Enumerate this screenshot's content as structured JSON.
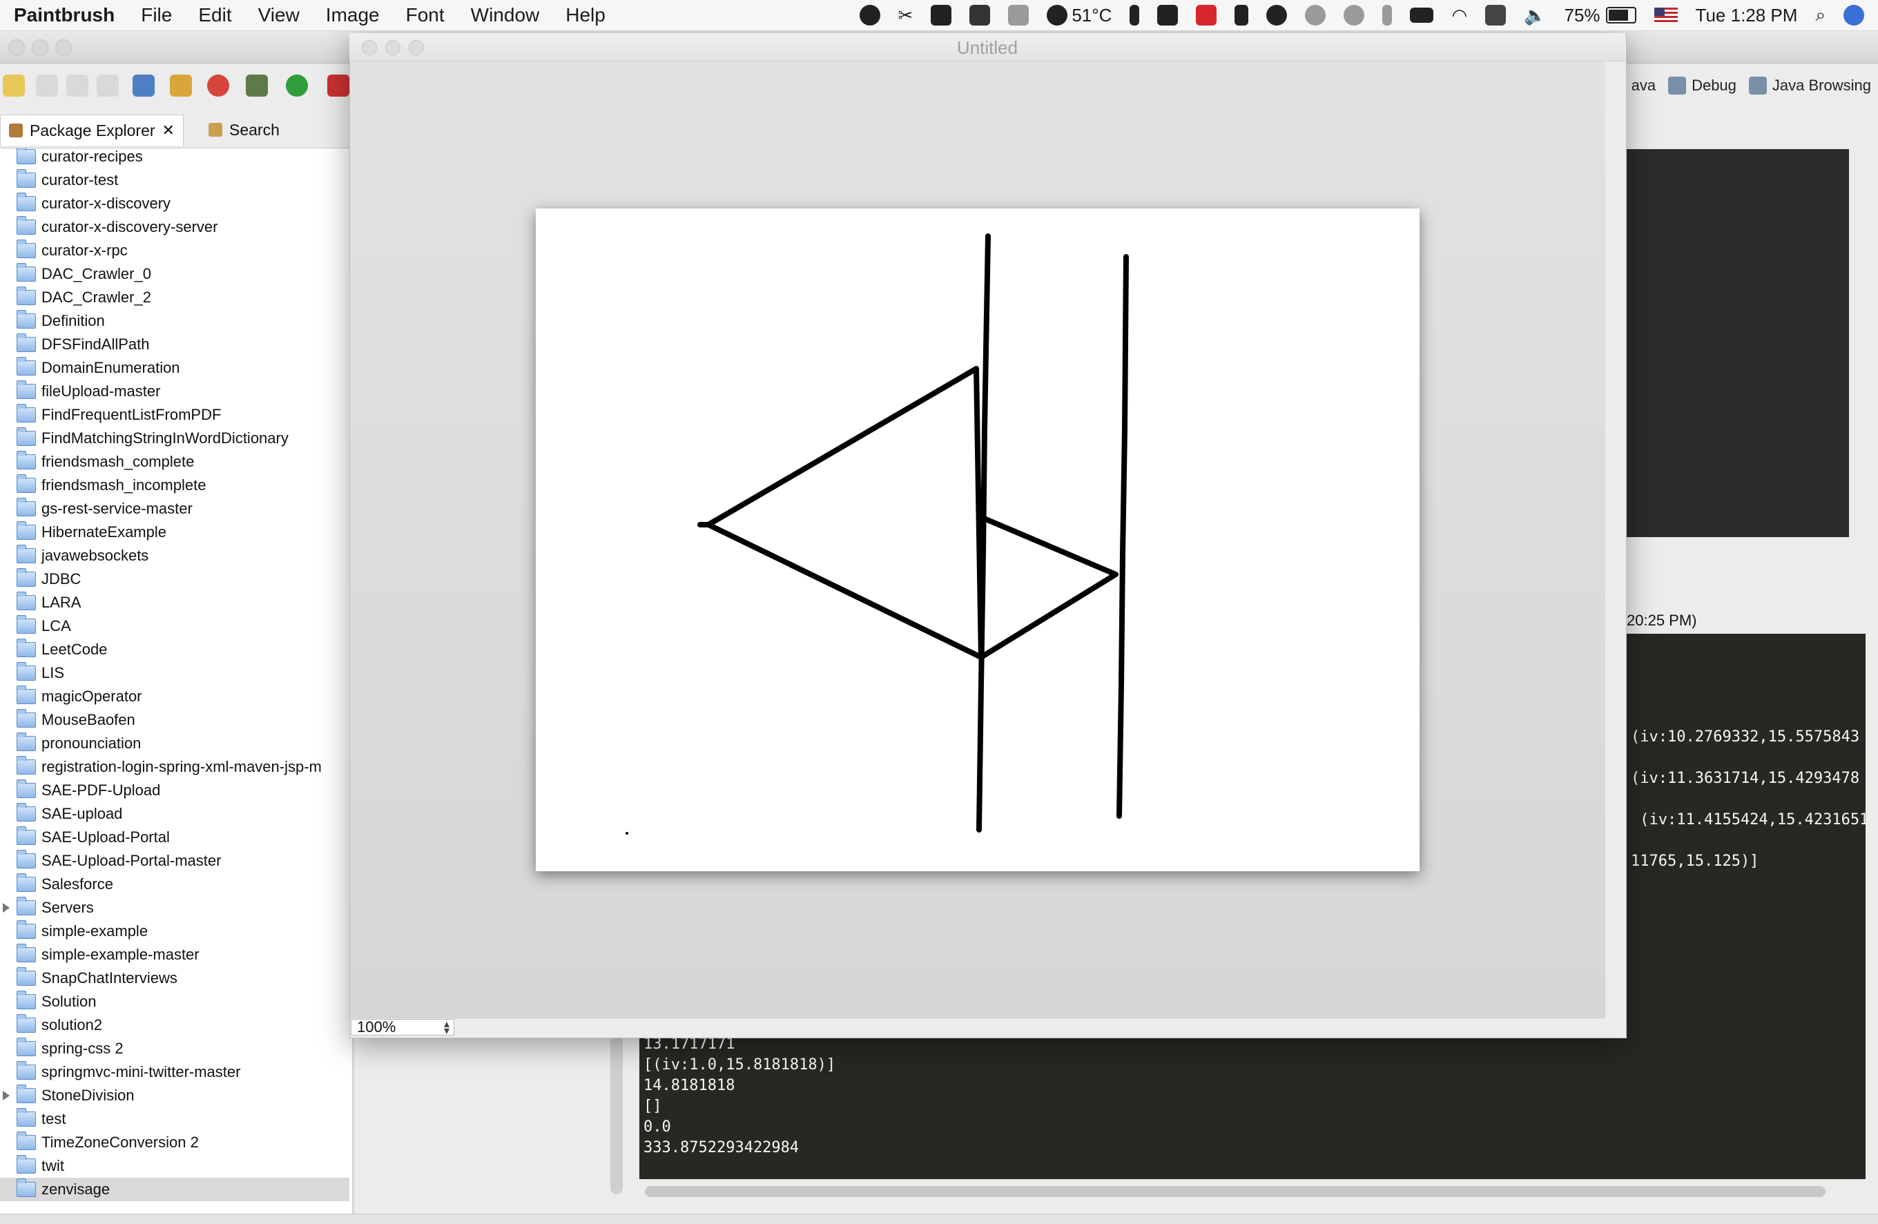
{
  "menubar": {
    "app": "Paintbrush",
    "items": [
      "File",
      "Edit",
      "View",
      "Image",
      "Font",
      "Window",
      "Help"
    ],
    "temperature": "51°C",
    "battery": "75%",
    "clock": "Tue 1:28 PM"
  },
  "eclipse": {
    "perspectives": [
      "ava",
      "Debug",
      "Java Browsing"
    ],
    "package_explorer": {
      "tab_label": "Package Explorer",
      "search_tab": "Search",
      "projects": [
        "curator-recipes",
        "curator-test",
        "curator-x-discovery",
        "curator-x-discovery-server",
        "curator-x-rpc",
        "DAC_Crawler_0",
        "DAC_Crawler_2",
        "Definition",
        "DFSFindAllPath",
        "DomainEnumeration",
        "fileUpload-master",
        "FindFrequentListFromPDF",
        "FindMatchingStringInWordDictionary",
        "friendsmash_complete",
        "friendsmash_incomplete",
        "gs-rest-service-master",
        "HibernateExample",
        "javawebsockets",
        "JDBC",
        "LARA",
        "LCA",
        "LeetCode",
        "LIS",
        "magicOperator",
        "MouseBaofen",
        "pronounciation",
        "registration-login-spring-xml-maven-jsp-m",
        "SAE-PDF-Upload",
        "SAE-upload",
        "SAE-Upload-Portal",
        "SAE-Upload-Portal-master",
        "Salesforce",
        "Servers",
        "simple-example",
        "simple-example-master",
        "SnapChatInterviews",
        "Solution",
        "solution2",
        "spring-css 2",
        "springmvc-mini-twitter-master",
        "StoneDivision",
        "test",
        "TimeZoneConversion 2",
        "twit",
        "zenvisage"
      ],
      "selected": "zenvisage"
    },
    "console_header": "20:25 PM)",
    "console_right_lines": [
      "(iv:10.2769332,15.5575843",
      "(iv:11.3631714,15.4293478",
      " (iv:11.4155424,15.4231651",
      "11765,15.125)]"
    ],
    "console_bottom_lines": [
      "13.1717171",
      "[(iv:1.0,15.8181818)]",
      "14.8181818",
      "[]",
      "0.0",
      "333.8752293422984"
    ]
  },
  "paintbrush": {
    "window_title": "Untitled",
    "zoom": "100%"
  }
}
